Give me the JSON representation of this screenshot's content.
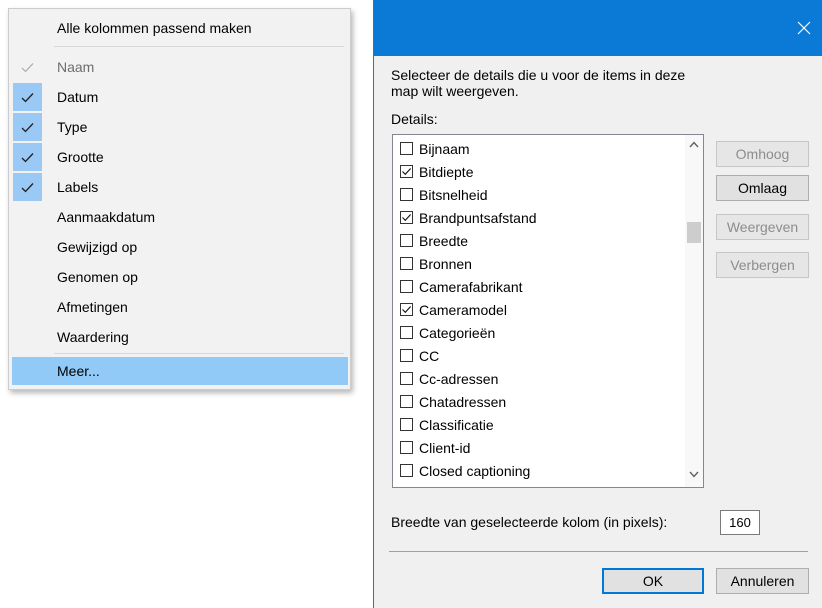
{
  "context_menu": {
    "fit_all": "Alle kolommen passend maken",
    "items": [
      {
        "label": "Naam",
        "checked": true,
        "disabled": true
      },
      {
        "label": "Datum",
        "checked": true,
        "disabled": false
      },
      {
        "label": "Type",
        "checked": true,
        "disabled": false
      },
      {
        "label": "Grootte",
        "checked": true,
        "disabled": false
      },
      {
        "label": "Labels",
        "checked": true,
        "disabled": false
      },
      {
        "label": "Aanmaakdatum",
        "checked": false,
        "disabled": false
      },
      {
        "label": "Gewijzigd op",
        "checked": false,
        "disabled": false
      },
      {
        "label": "Genomen op",
        "checked": false,
        "disabled": false
      },
      {
        "label": "Afmetingen",
        "checked": false,
        "disabled": false
      },
      {
        "label": "Waardering",
        "checked": false,
        "disabled": false
      }
    ],
    "more": "Meer..."
  },
  "dialog": {
    "intro": "Selecteer de details die u voor de items in deze map wilt weergeven.",
    "details_label": "Details:",
    "details": [
      {
        "label": "Bijnaam",
        "checked": false
      },
      {
        "label": "Bitdiepte",
        "checked": true
      },
      {
        "label": "Bitsnelheid",
        "checked": false
      },
      {
        "label": "Brandpuntsafstand",
        "checked": true
      },
      {
        "label": "Breedte",
        "checked": false
      },
      {
        "label": "Bronnen",
        "checked": false
      },
      {
        "label": "Camerafabrikant",
        "checked": false
      },
      {
        "label": "Cameramodel",
        "checked": true
      },
      {
        "label": "Categorieën",
        "checked": false
      },
      {
        "label": "CC",
        "checked": false
      },
      {
        "label": "Cc-adressen",
        "checked": false
      },
      {
        "label": "Chatadressen",
        "checked": false
      },
      {
        "label": "Classificatie",
        "checked": false
      },
      {
        "label": "Client-id",
        "checked": false
      },
      {
        "label": "Closed captioning",
        "checked": false
      }
    ],
    "buttons": {
      "up": "Omhoog",
      "down": "Omlaag",
      "show": "Weergeven",
      "hide": "Verbergen",
      "ok": "OK",
      "cancel": "Annuleren"
    },
    "width_label": "Breedte van geselecteerde kolom (in pixels):",
    "width_value": "160"
  },
  "colors": {
    "title_bar": "#0b79d6",
    "highlight": "#91c9f7",
    "check_bg": "#99c9f4"
  },
  "icons": {
    "check": "check-icon",
    "close": "close-icon",
    "scroll_up": "chevron-up-icon",
    "scroll_down": "chevron-down-icon"
  }
}
